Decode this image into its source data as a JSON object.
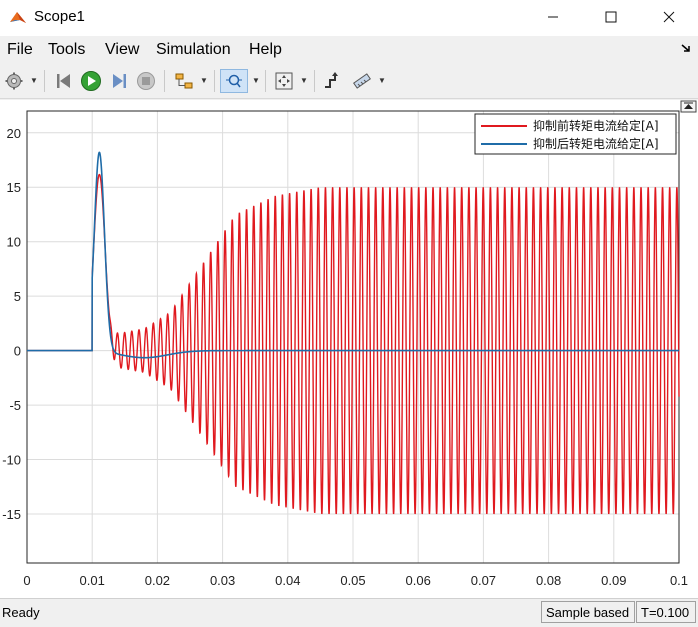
{
  "window": {
    "title": "Scope1"
  },
  "menu": [
    "File",
    "Tools",
    "View",
    "Simulation",
    "Help"
  ],
  "toolbar": [
    "settings-icon",
    "step-back-icon",
    "run-icon",
    "step-forward-icon",
    "stop-icon",
    "highlight-block-icon",
    "zoom-icon",
    "fit-to-view-icon",
    "cursor-measurements-icon",
    "style-icon"
  ],
  "colors": {
    "before": "#e0191f",
    "after": "#1f6ca8",
    "grid": "#dcdcdc"
  },
  "status": {
    "text": "Ready",
    "sample": "Sample based",
    "time": "T=0.100"
  },
  "chart_data": {
    "type": "line",
    "xlim": [
      0,
      0.1
    ],
    "ylim": [
      -19.5,
      22
    ],
    "xticks": [
      "0",
      "0.01",
      "0.02",
      "0.03",
      "0.04",
      "0.05",
      "0.06",
      "0.07",
      "0.08",
      "0.09",
      "0.1"
    ],
    "xtick_values": [
      0,
      0.01,
      0.02,
      0.03,
      0.04,
      0.05,
      0.06,
      0.07,
      0.08,
      0.09,
      0.1
    ],
    "yticks": [
      "-15",
      "-10",
      "-5",
      "0",
      "5",
      "10",
      "15",
      "20"
    ],
    "ytick_values": [
      -15,
      -10,
      -5,
      0,
      5,
      10,
      15,
      20
    ],
    "grid": true,
    "legend_position": "top-right",
    "series": [
      {
        "name": "抑制前转矩电流给定[A]",
        "color": "#e0191f",
        "description_points": {
          "step_time": 0.01,
          "peak": 16.2,
          "peak_time": 0.011,
          "oscillation_period": 0.0011,
          "envelope": [
            [
              0.0135,
              1.5
            ],
            [
              0.018,
              2.0
            ],
            [
              0.022,
              3.5
            ],
            [
              0.027,
              8.0
            ],
            [
              0.032,
              12.5
            ],
            [
              0.038,
              14.2
            ],
            [
              0.045,
              15.0
            ],
            [
              0.1,
              15.0
            ]
          ]
        }
      },
      {
        "name": "抑制后转矩电流给定[A]",
        "color": "#1f6ca8",
        "description_points": {
          "step_time": 0.01,
          "peak": 17.9,
          "peak_time": 0.0111,
          "min": -0.6,
          "min_time": 0.018,
          "settle_time": 0.03
        }
      }
    ]
  }
}
